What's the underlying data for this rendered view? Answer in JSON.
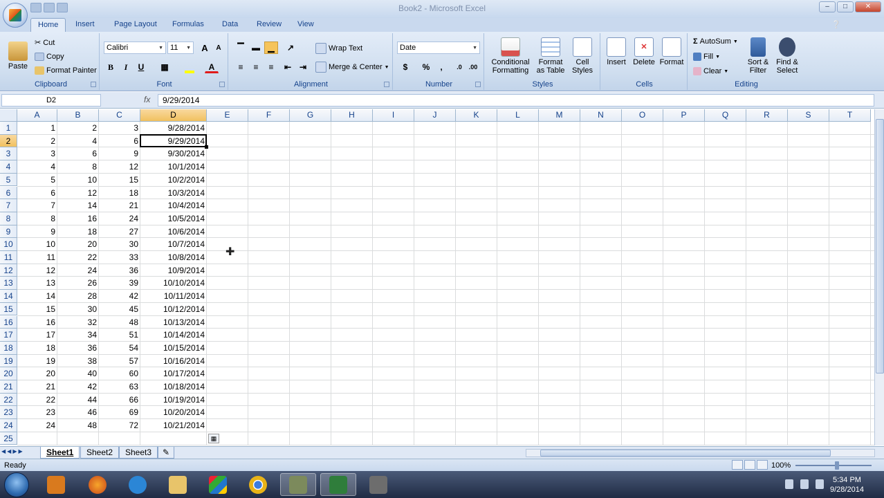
{
  "window": {
    "title": "Book2 - Microsoft Excel"
  },
  "ribbon_tabs": [
    "Home",
    "Insert",
    "Page Layout",
    "Formulas",
    "Data",
    "Review",
    "View"
  ],
  "clipboard": {
    "paste": "Paste",
    "cut": "Cut",
    "copy": "Copy",
    "format_painter": "Format Painter",
    "label": "Clipboard"
  },
  "font": {
    "name": "Calibri",
    "size": "11",
    "label": "Font",
    "bold": "B",
    "italic": "I",
    "underline": "U",
    "grow": "A",
    "shrink": "A"
  },
  "alignment": {
    "wrap_text": "Wrap Text",
    "merge_center": "Merge & Center",
    "label": "Alignment"
  },
  "number": {
    "format": "Date",
    "currency": "$",
    "percent": "%",
    "comma": ",",
    "label": "Number"
  },
  "styles": {
    "conditional": "Conditional Formatting",
    "format_table": "Format as Table",
    "cell_styles": "Cell Styles",
    "label": "Styles"
  },
  "cells": {
    "insert": "Insert",
    "delete": "Delete",
    "format": "Format",
    "label": "Cells"
  },
  "editing": {
    "autosum": "AutoSum",
    "fill": "Fill",
    "clear": "Clear",
    "sort_filter": "Sort & Filter",
    "find_select": "Find & Select",
    "label": "Editing"
  },
  "formula_bar": {
    "name_box": "D2",
    "fx": "fx",
    "value": "9/29/2014"
  },
  "columns": [
    "A",
    "B",
    "C",
    "D",
    "E",
    "F",
    "G",
    "H",
    "I",
    "J",
    "K",
    "L",
    "M",
    "N",
    "O",
    "P",
    "Q",
    "R",
    "S",
    "T"
  ],
  "selected_column": "D",
  "selected_row": 2,
  "rows": [
    [
      "1",
      "2",
      "3",
      "9/28/2014"
    ],
    [
      "2",
      "4",
      "6",
      "9/29/2014"
    ],
    [
      "3",
      "6",
      "9",
      "9/30/2014"
    ],
    [
      "4",
      "8",
      "12",
      "10/1/2014"
    ],
    [
      "5",
      "10",
      "15",
      "10/2/2014"
    ],
    [
      "6",
      "12",
      "18",
      "10/3/2014"
    ],
    [
      "7",
      "14",
      "21",
      "10/4/2014"
    ],
    [
      "8",
      "16",
      "24",
      "10/5/2014"
    ],
    [
      "9",
      "18",
      "27",
      "10/6/2014"
    ],
    [
      "10",
      "20",
      "30",
      "10/7/2014"
    ],
    [
      "11",
      "22",
      "33",
      "10/8/2014"
    ],
    [
      "12",
      "24",
      "36",
      "10/9/2014"
    ],
    [
      "13",
      "26",
      "39",
      "10/10/2014"
    ],
    [
      "14",
      "28",
      "42",
      "10/11/2014"
    ],
    [
      "15",
      "30",
      "45",
      "10/12/2014"
    ],
    [
      "16",
      "32",
      "48",
      "10/13/2014"
    ],
    [
      "17",
      "34",
      "51",
      "10/14/2014"
    ],
    [
      "18",
      "36",
      "54",
      "10/15/2014"
    ],
    [
      "19",
      "38",
      "57",
      "10/16/2014"
    ],
    [
      "20",
      "40",
      "60",
      "10/17/2014"
    ],
    [
      "21",
      "42",
      "63",
      "10/18/2014"
    ],
    [
      "22",
      "44",
      "66",
      "10/19/2014"
    ],
    [
      "23",
      "46",
      "69",
      "10/20/2014"
    ],
    [
      "24",
      "48",
      "72",
      "10/21/2014"
    ]
  ],
  "row_count": 25,
  "sheets": [
    "Sheet1",
    "Sheet2",
    "Sheet3"
  ],
  "active_sheet": "Sheet1",
  "status": {
    "ready": "Ready",
    "zoom": "100%"
  },
  "clock": {
    "time": "5:34 PM",
    "date": "9/28/2014"
  }
}
